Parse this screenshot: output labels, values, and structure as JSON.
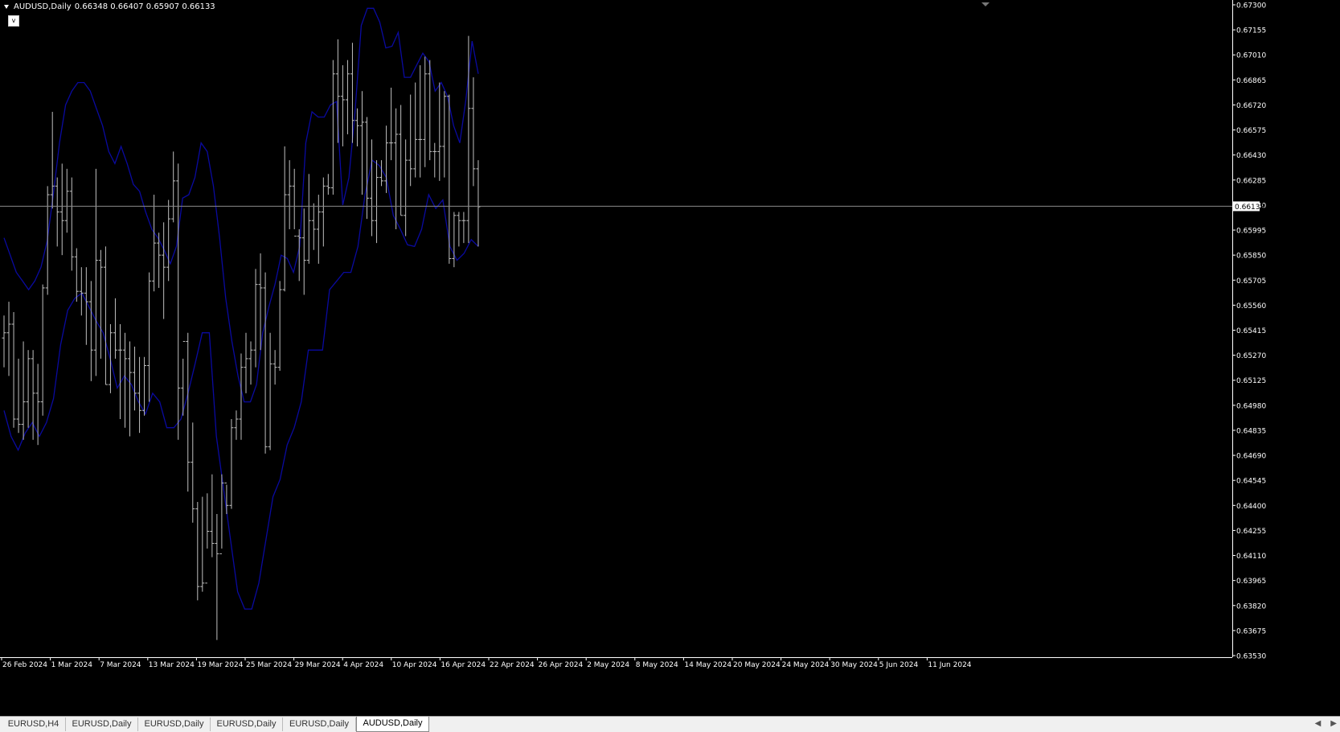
{
  "window": {
    "symbol_title": "AUDUSD,Daily",
    "ohlc_readout": "0.66348 0.66407 0.65907 0.66133",
    "one_click_label": "v"
  },
  "colors": {
    "background": "#000000",
    "bars": "#c0c0c0",
    "bands": "#0a0aa0",
    "grid_line": "#8a8a8a",
    "axis_text": "#ffffff",
    "price_label_bg": "#ffffff"
  },
  "chart_data": {
    "type": "ohlc",
    "symbol": "AUDUSD",
    "timeframe": "Daily",
    "current_price": 0.66133,
    "current_price_label": "0.66133",
    "price_ticks": [
      "0.67300",
      "0.67155",
      "0.67010",
      "0.66865",
      "0.66720",
      "0.66575",
      "0.66430",
      "0.66285",
      "0.66140",
      "0.65995",
      "0.65850",
      "0.65705",
      "0.65560",
      "0.65415",
      "0.65270",
      "0.65125",
      "0.64980",
      "0.64835",
      "0.64690",
      "0.64545",
      "0.64400",
      "0.64255",
      "0.64110",
      "0.63965",
      "0.63820",
      "0.63675",
      "0.63530"
    ],
    "ylim": [
      0.6353,
      0.673
    ],
    "date_labels": [
      "26 Feb 2024",
      "1 Mar 2024",
      "7 Mar 2024",
      "13 Mar 2024",
      "19 Mar 2024",
      "25 Mar 2024",
      "29 Mar 2024",
      "4 Apr 2024",
      "10 Apr 2024",
      "16 Apr 2024",
      "22 Apr 2024",
      "26 Apr 2024",
      "2 May 2024",
      "8 May 2024",
      "14 May 2024",
      "20 May 2024",
      "24 May 2024",
      "30 May 2024",
      "5 Jun 2024",
      "11 Jun 2024"
    ],
    "bars": [
      [
        0.6537,
        0.655,
        0.652,
        0.654
      ],
      [
        0.654,
        0.6558,
        0.6515,
        0.6545
      ],
      [
        0.6545,
        0.6552,
        0.6485,
        0.649
      ],
      [
        0.649,
        0.6525,
        0.6482,
        0.6487
      ],
      [
        0.6487,
        0.6535,
        0.6478,
        0.65
      ],
      [
        0.65,
        0.653,
        0.6485,
        0.6525
      ],
      [
        0.6525,
        0.653,
        0.6478,
        0.6505
      ],
      [
        0.6505,
        0.6522,
        0.6475,
        0.65
      ],
      [
        0.65,
        0.6568,
        0.6492,
        0.6566
      ],
      [
        0.6566,
        0.6625,
        0.6562,
        0.662
      ],
      [
        0.662,
        0.6668,
        0.6612,
        0.6625
      ],
      [
        0.6625,
        0.663,
        0.659,
        0.661
      ],
      [
        0.661,
        0.6638,
        0.6585,
        0.6605
      ],
      [
        0.6605,
        0.6635,
        0.6598,
        0.6622
      ],
      [
        0.6622,
        0.663,
        0.6576,
        0.6584
      ],
      [
        0.6584,
        0.6589,
        0.6558,
        0.6564
      ],
      [
        0.6564,
        0.6578,
        0.655,
        0.6563
      ],
      [
        0.6563,
        0.6578,
        0.6533,
        0.6558
      ],
      [
        0.6558,
        0.657,
        0.6512,
        0.653
      ],
      [
        0.653,
        0.6635,
        0.6515,
        0.6582
      ],
      [
        0.6582,
        0.6588,
        0.6525,
        0.6578
      ],
      [
        0.6578,
        0.659,
        0.651,
        0.651
      ],
      [
        0.651,
        0.6545,
        0.6505,
        0.654
      ],
      [
        0.654,
        0.656,
        0.6525,
        0.653
      ],
      [
        0.653,
        0.6545,
        0.649,
        0.653
      ],
      [
        0.653,
        0.654,
        0.6485,
        0.6525
      ],
      [
        0.6525,
        0.6535,
        0.648,
        0.6517
      ],
      [
        0.6517,
        0.6532,
        0.6495,
        0.6505
      ],
      [
        0.6505,
        0.6526,
        0.6482,
        0.6495
      ],
      [
        0.6495,
        0.6526,
        0.6492,
        0.6521
      ],
      [
        0.6521,
        0.6575,
        0.65,
        0.657
      ],
      [
        0.657,
        0.662,
        0.6564,
        0.6592
      ],
      [
        0.6592,
        0.6598,
        0.6566,
        0.6585
      ],
      [
        0.6585,
        0.6604,
        0.6548,
        0.6578
      ],
      [
        0.6578,
        0.6617,
        0.657,
        0.6606
      ],
      [
        0.6606,
        0.6645,
        0.6604,
        0.6628
      ],
      [
        0.6628,
        0.6638,
        0.6478,
        0.6508
      ],
      [
        0.6508,
        0.6525,
        0.6492,
        0.6535
      ],
      [
        0.6535,
        0.654,
        0.6448,
        0.6465
      ],
      [
        0.6465,
        0.6488,
        0.643,
        0.6438
      ],
      [
        0.6438,
        0.6442,
        0.6385,
        0.6393
      ],
      [
        0.6393,
        0.6445,
        0.639,
        0.6395
      ],
      [
        0.6395,
        0.6447,
        0.6415,
        0.6425
      ],
      [
        0.6425,
        0.6458,
        0.641,
        0.6418
      ],
      [
        0.6418,
        0.6435,
        0.6362,
        0.6412
      ],
      [
        0.6412,
        0.6458,
        0.6415,
        0.6453
      ],
      [
        0.6453,
        0.6452,
        0.6435,
        0.644
      ],
      [
        0.644,
        0.649,
        0.6438,
        0.6485
      ],
      [
        0.6485,
        0.6495,
        0.6478,
        0.649
      ],
      [
        0.649,
        0.6528,
        0.6478,
        0.652
      ],
      [
        0.652,
        0.654,
        0.6505,
        0.6525
      ],
      [
        0.6525,
        0.6535,
        0.651,
        0.653
      ],
      [
        0.653,
        0.6577,
        0.652,
        0.6568
      ],
      [
        0.6568,
        0.6586,
        0.653,
        0.6566
      ],
      [
        0.6566,
        0.6575,
        0.647,
        0.6474
      ],
      [
        0.6474,
        0.654,
        0.6472,
        0.6522
      ],
      [
        0.6522,
        0.653,
        0.651,
        0.652
      ],
      [
        0.652,
        0.657,
        0.6518,
        0.6565
      ],
      [
        0.6565,
        0.6648,
        0.6564,
        0.662
      ],
      [
        0.662,
        0.664,
        0.66,
        0.6625
      ],
      [
        0.6625,
        0.6635,
        0.66,
        0.6596
      ],
      [
        0.6596,
        0.66,
        0.657,
        0.6595
      ],
      [
        0.6595,
        0.6612,
        0.6562,
        0.6582
      ],
      [
        0.6582,
        0.6632,
        0.658,
        0.6605
      ],
      [
        0.6605,
        0.6615,
        0.6588,
        0.66
      ],
      [
        0.66,
        0.662,
        0.658,
        0.661
      ],
      [
        0.661,
        0.663,
        0.659,
        0.6625
      ],
      [
        0.6625,
        0.6632,
        0.662,
        0.6624
      ],
      [
        0.6624,
        0.6698,
        0.662,
        0.669
      ],
      [
        0.669,
        0.671,
        0.665,
        0.6677
      ],
      [
        0.6677,
        0.6695,
        0.6648,
        0.6675
      ],
      [
        0.6675,
        0.6698,
        0.6655,
        0.669
      ],
      [
        0.669,
        0.6708,
        0.665,
        0.6663
      ],
      [
        0.6663,
        0.667,
        0.6648,
        0.666
      ],
      [
        0.666,
        0.668,
        0.662,
        0.6662
      ],
      [
        0.6662,
        0.6665,
        0.6606,
        0.6618
      ],
      [
        0.6618,
        0.6652,
        0.6596,
        0.6605
      ],
      [
        0.6605,
        0.664,
        0.6592,
        0.663
      ],
      [
        0.663,
        0.664,
        0.6625,
        0.6628
      ],
      [
        0.6628,
        0.666,
        0.6621,
        0.665
      ],
      [
        0.665,
        0.6682,
        0.664,
        0.665
      ],
      [
        0.665,
        0.667,
        0.66,
        0.6655
      ],
      [
        0.6655,
        0.6672,
        0.6608,
        0.6608
      ],
      [
        0.6608,
        0.6652,
        0.6596,
        0.664
      ],
      [
        0.664,
        0.6678,
        0.6625,
        0.6635
      ],
      [
        0.6635,
        0.6685,
        0.663,
        0.6652
      ],
      [
        0.6652,
        0.6695,
        0.663,
        0.6652
      ],
      [
        0.6652,
        0.67,
        0.6636,
        0.669
      ],
      [
        0.669,
        0.6698,
        0.664,
        0.6645
      ],
      [
        0.6645,
        0.665,
        0.663,
        0.6645
      ],
      [
        0.6645,
        0.6685,
        0.6628,
        0.6648
      ],
      [
        0.6648,
        0.668,
        0.663,
        0.6677
      ],
      [
        0.6677,
        0.6678,
        0.658,
        0.6583
      ],
      [
        0.6583,
        0.661,
        0.6578,
        0.6608
      ],
      [
        0.6608,
        0.661,
        0.659,
        0.6605
      ],
      [
        0.6605,
        0.661,
        0.6592,
        0.6605
      ],
      [
        0.6605,
        0.6712,
        0.6592,
        0.667
      ],
      [
        0.667,
        0.6688,
        0.6625,
        0.6635
      ],
      [
        0.6635,
        0.664,
        0.659,
        0.6613
      ]
    ],
    "upper_band": [
      0.6595,
      0.6585,
      0.6575,
      0.657,
      0.6565,
      0.657,
      0.6578,
      0.6593,
      0.662,
      0.665,
      0.6672,
      0.668,
      0.6685,
      0.6685,
      0.668,
      0.667,
      0.666,
      0.6645,
      0.6638,
      0.6648,
      0.6638,
      0.6626,
      0.6622,
      0.661,
      0.66,
      0.6595,
      0.6588,
      0.658,
      0.659,
      0.6618,
      0.662,
      0.663,
      0.665,
      0.6645,
      0.6625,
      0.6595,
      0.656,
      0.6535,
      0.6515,
      0.65,
      0.65,
      0.651,
      0.654,
      0.6555,
      0.6568,
      0.6585,
      0.6583,
      0.6575,
      0.659,
      0.665,
      0.6668,
      0.6665,
      0.6665,
      0.6672,
      0.6674,
      0.6614,
      0.663,
      0.6668,
      0.6718,
      0.6728,
      0.6728,
      0.672,
      0.6705,
      0.6706,
      0.6714,
      0.6688,
      0.6688,
      0.6695,
      0.6702,
      0.6697,
      0.668,
      0.6685,
      0.6677,
      0.666,
      0.665,
      0.6675,
      0.6709,
      0.669
    ],
    "lower_band": [
      0.6495,
      0.648,
      0.6472,
      0.6482,
      0.6488,
      0.648,
      0.6488,
      0.6502,
      0.6533,
      0.6553,
      0.656,
      0.6563,
      0.6555,
      0.6547,
      0.654,
      0.6525,
      0.6508,
      0.6515,
      0.651,
      0.65,
      0.6493,
      0.6505,
      0.65,
      0.6485,
      0.6485,
      0.649,
      0.6505,
      0.6522,
      0.654,
      0.654,
      0.648,
      0.645,
      0.642,
      0.639,
      0.638,
      0.638,
      0.6395,
      0.642,
      0.6445,
      0.6455,
      0.6475,
      0.6485,
      0.65,
      0.653,
      0.653,
      0.653,
      0.6565,
      0.657,
      0.6575,
      0.6575,
      0.659,
      0.662,
      0.664,
      0.6637,
      0.663,
      0.6608,
      0.66,
      0.6591,
      0.659,
      0.66,
      0.662,
      0.6612,
      0.6617,
      0.659,
      0.6582,
      0.6586,
      0.6594,
      0.659
    ],
    "band_x_index": null
  },
  "tabs": [
    {
      "label": "EURUSD,H4",
      "active": false
    },
    {
      "label": "EURUSD,Daily",
      "active": false
    },
    {
      "label": "EURUSD,Daily",
      "active": false
    },
    {
      "label": "EURUSD,Daily",
      "active": false
    },
    {
      "label": "EURUSD,Daily",
      "active": false
    },
    {
      "label": "AUDUSD,Daily",
      "active": true
    }
  ],
  "tab_scroll": {
    "left": "◀",
    "right": "▶"
  }
}
